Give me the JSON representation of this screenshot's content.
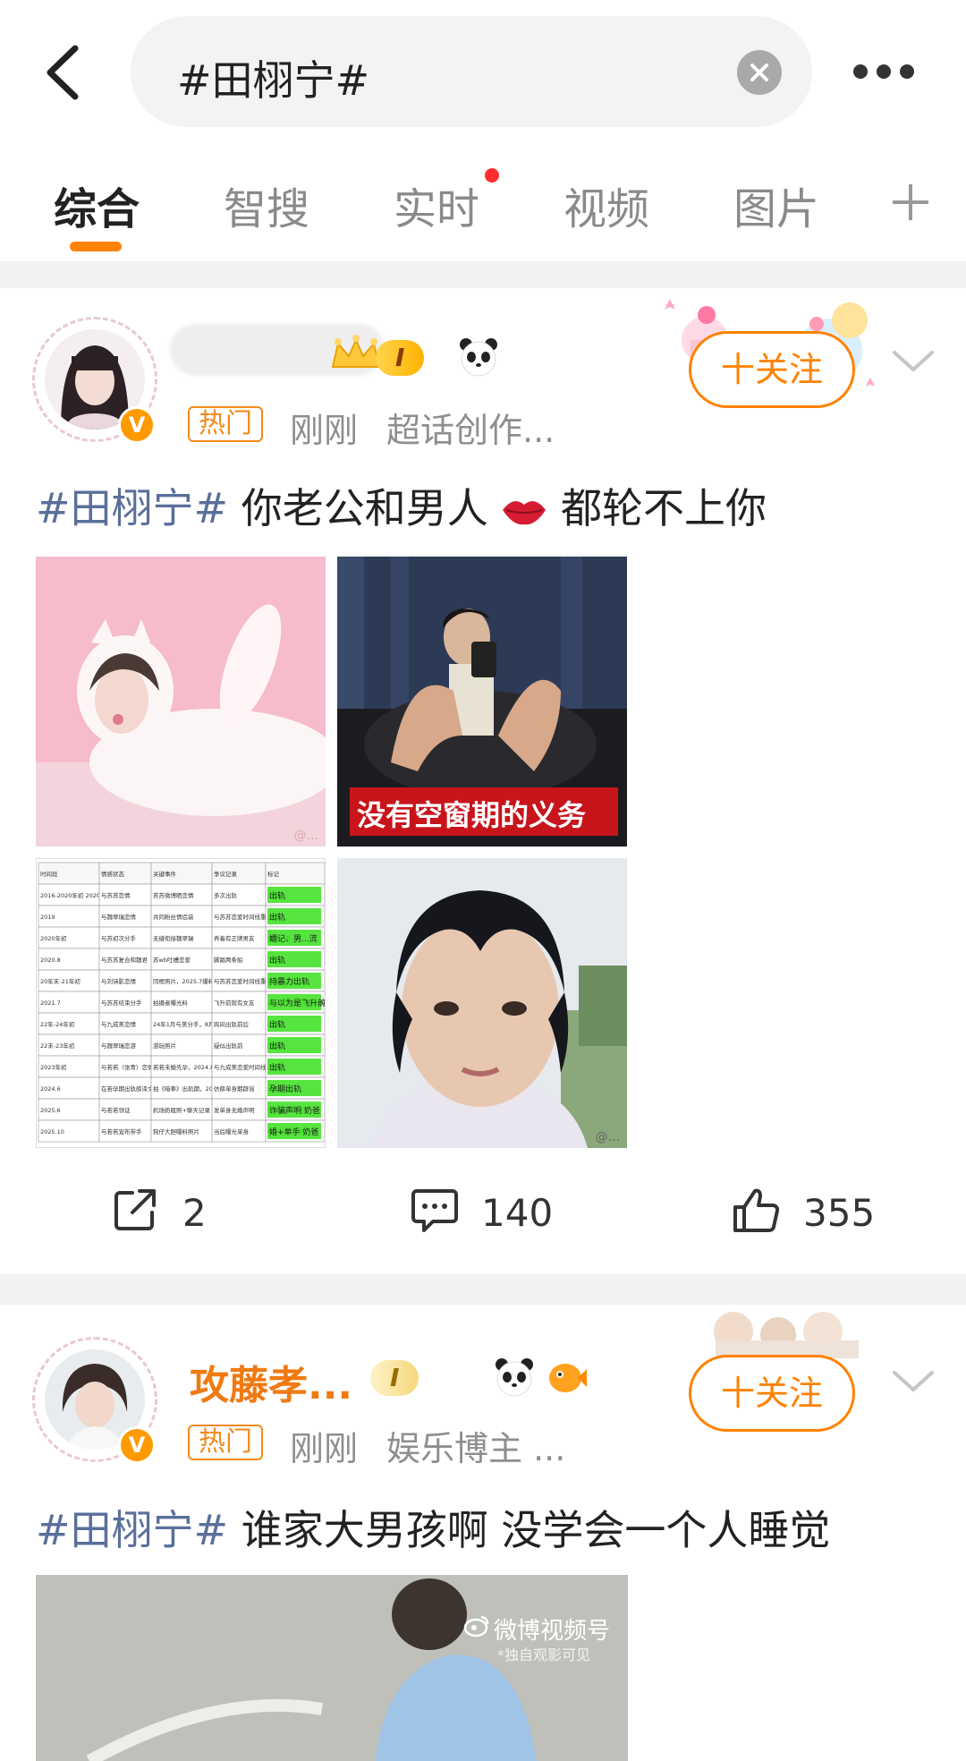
{
  "search": {
    "query": "#田栩宁#"
  },
  "tabs": [
    {
      "label": "综合"
    },
    {
      "label": "智搜"
    },
    {
      "label": "实时"
    },
    {
      "label": "视频"
    },
    {
      "label": "图片"
    }
  ],
  "posts": [
    {
      "username": "",
      "level": "I",
      "tag": "热门",
      "time": "刚刚",
      "source": "超话创作...",
      "follow_label": "十关注",
      "hashtag": "#田栩宁#",
      "text_before": "你老公和男人",
      "text_after": "都轮不上你",
      "image_caption": "没有空窗期的义务",
      "table": {
        "headers": [
          "时间段",
          "情感状态",
          "关键事件",
          "争议记录",
          "标记"
        ],
        "rows": [
          [
            "2016-2020年初 2020.8-2021.7",
            "与苏苏恋情",
            "苏苏微博晒恋情",
            "多次出轨",
            "出轨"
          ],
          [
            "2019",
            "与魏翠瑞恋情",
            "共同粉丝情侣装",
            "与苏苏恋爱时间线重合",
            "出轨"
          ],
          [
            "2020年初",
            "与苏初次分手",
            "无缝衔接魏翠瑞",
            "养着有正牌男友",
            "媚记、男...流"
          ],
          [
            "2020.8",
            "与苏苏复合和魏君",
            "苏wb吐槽恋爱",
            "脚踏两条船",
            "出轨"
          ],
          [
            "20年末-21年初",
            "与刘诗影恋情",
            "同框照片，2025.7爆料",
            "与苏苏恋爱时间线重合",
            "持暴力出轨"
          ],
          [
            "2021.7",
            "与苏苏结束分手",
            "拍摄者曝光料",
            "飞升前就有女友",
            "与以为是飞升前的女友"
          ],
          [
            "22年-24年初",
            "与九成美恋情",
            "24年1月与美分手，8月初孩子出生",
            "跨间出轨前后",
            "出轨"
          ],
          [
            "22末-23年初",
            "与魏翠瑞恋游",
            "游玩照片",
            "疑似出轨前",
            "出轨"
          ],
          [
            "2023年初",
            "与若若（张青）恋情",
            "若若未婚先孕，2024.8孩子出生",
            "与九成美恋爱时间线重合",
            "出轨"
          ],
          [
            "2024.6",
            "在若孕期出轨薛泽文",
            "拍《暗拳》出轨期，2025.7曝聊天记录",
            "仿薛单身期辟谣",
            "孕期出轨"
          ],
          [
            "2025.6",
            "与若若领证",
            "机场奶瓶照+聊天记录",
            "发单身无婚声明",
            "诈骗声明 奶爸"
          ],
          [
            "2025.10",
            "与若若宣布带手",
            "狗仔大胆曝料照片",
            "当后曝光单身",
            "婚+单手 奶爸"
          ]
        ]
      },
      "stats": {
        "reposts": "2",
        "comments": "140",
        "likes": "355"
      }
    },
    {
      "username": "攻藤孝...",
      "level": "I",
      "tag": "热门",
      "time": "刚刚",
      "source": "娱乐博主 ...",
      "follow_label": "十关注",
      "hashtag": "#田栩宁#",
      "text_before": "谁家大男孩啊 没学会一个人睡觉",
      "video_watermark": "微博视频号",
      "video_watermark_sub": "*独自观影可见"
    }
  ],
  "colors": {
    "accent": "#ff8200",
    "hashtag": "#5a6f9a",
    "username": "#f07a12",
    "muted": "#8e8e8e",
    "divider": "#f2f2f2"
  },
  "icons": {
    "back": "chevron-left-icon",
    "clear": "close-circle-icon",
    "more": "more-horizontal-icon",
    "add_tab": "plus-icon",
    "repost": "share-icon",
    "comment": "comment-icon",
    "like": "thumb-up-icon"
  }
}
